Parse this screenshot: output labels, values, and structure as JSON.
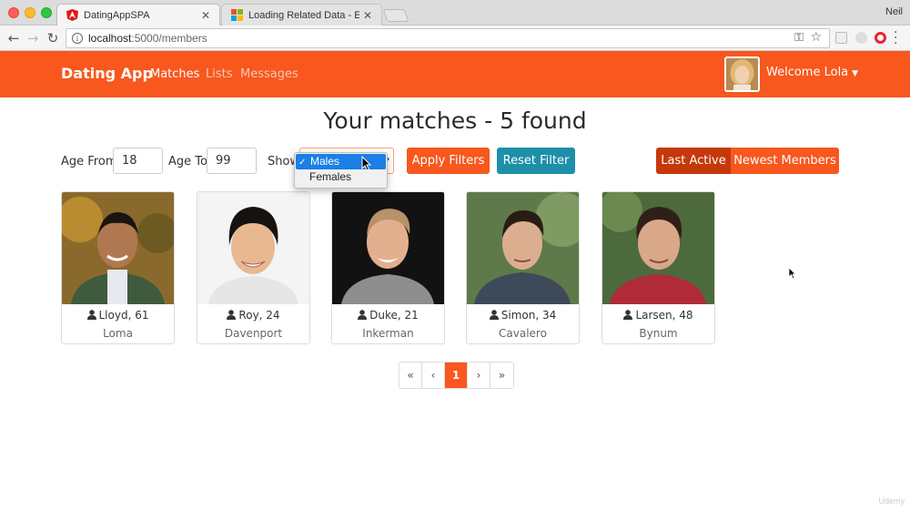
{
  "browser": {
    "user": "Neil",
    "tabs": [
      {
        "title": "DatingAppSPA",
        "active": true
      },
      {
        "title": "Loading Related Data - EF Cor",
        "active": false
      }
    ],
    "url_host": "localhost",
    "url_path": ":5000/members"
  },
  "navbar": {
    "brand": "Dating App",
    "links": [
      "Matches",
      "Lists",
      "Messages"
    ],
    "active_link": "Matches",
    "welcome": "Welcome Lola",
    "color": "#f8571e"
  },
  "page": {
    "title": "Your matches - 5 found"
  },
  "filters": {
    "age_from_label": "Age From",
    "age_from_value": "18",
    "age_to_label": "Age To",
    "age_to_value": "99",
    "show_label": "Show",
    "gender_options": [
      "Males",
      "Females"
    ],
    "selected_gender": "Males",
    "apply_label": "Apply Filters",
    "reset_label": "Reset Filter"
  },
  "sort": {
    "options": [
      "Last Active",
      "Newest Members"
    ],
    "active": "Last Active"
  },
  "members": [
    {
      "name_age": "Lloyd, 61",
      "city": "Loma"
    },
    {
      "name_age": "Roy, 24",
      "city": "Davenport"
    },
    {
      "name_age": "Duke, 21",
      "city": "Inkerman"
    },
    {
      "name_age": "Simon, 34",
      "city": "Cavalero"
    },
    {
      "name_age": "Larsen, 48",
      "city": "Bynum"
    }
  ],
  "pagination": {
    "first": "«",
    "prev": "‹",
    "current": "1",
    "next": "›",
    "last": "»"
  },
  "watermark": "Udemy"
}
